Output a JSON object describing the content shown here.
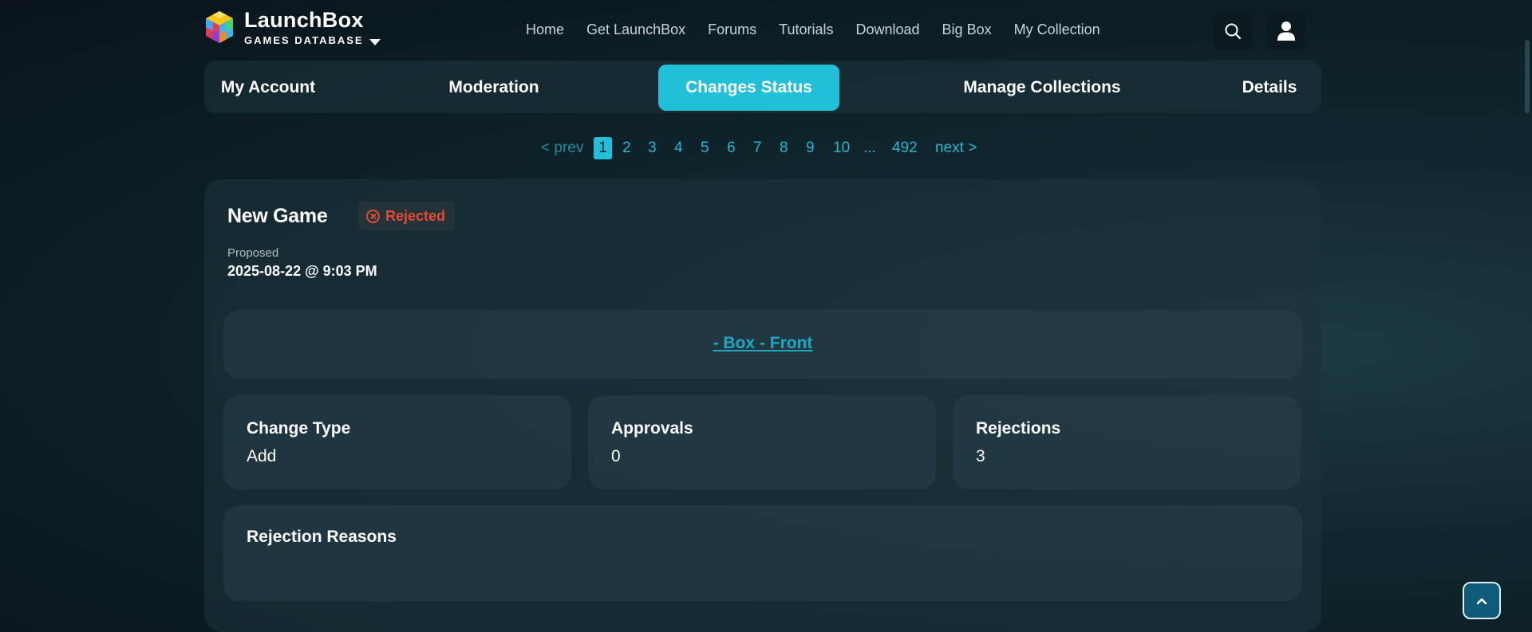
{
  "brand": {
    "title": "LaunchBox",
    "subtitle": "GAMES DATABASE"
  },
  "nav": [
    "Home",
    "Get LaunchBox",
    "Forums",
    "Tutorials",
    "Download",
    "Big Box",
    "My Collection"
  ],
  "tabs": [
    "My Account",
    "Moderation",
    "Changes Status",
    "Manage Collections",
    "Details"
  ],
  "active_tab": "Changes Status",
  "pager": {
    "prev": "< prev",
    "pages": [
      "1",
      "2",
      "3",
      "4",
      "5",
      "6",
      "7",
      "8",
      "9",
      "10"
    ],
    "ellipsis": "...",
    "last": "492",
    "next": "next >",
    "current": "1"
  },
  "change": {
    "title": "New Game",
    "status": "Rejected",
    "proposed_label": "Proposed",
    "proposed_value": "2025-08-22 @ 9:03 PM",
    "image_alt": "- Box - Front",
    "change_type_label": "Change Type",
    "change_type_value": "Add",
    "approvals_label": "Approvals",
    "approvals_value": "0",
    "rejections_label": "Rejections",
    "rejections_value": "3",
    "reasons_label": "Rejection Reasons"
  },
  "colors": {
    "accent": "#22c0d8",
    "rejected": "#e54b33",
    "link": "#1fb9d2"
  },
  "icons": {
    "search": "search-icon",
    "user": "user-icon",
    "totop": "chevron-up-icon",
    "logo": "cube-logo-icon"
  }
}
